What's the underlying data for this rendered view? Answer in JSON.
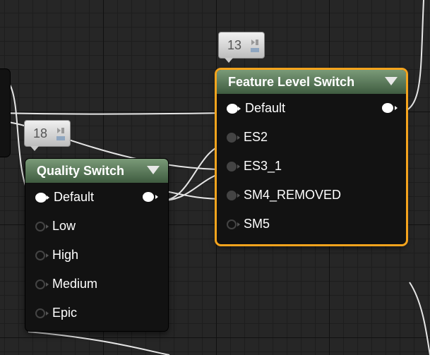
{
  "feature_level_node": {
    "title": "Feature Level Switch",
    "badge": "13",
    "pins": [
      "Default",
      "ES2",
      "ES3_1",
      "SM4_REMOVED",
      "SM5"
    ]
  },
  "quality_node": {
    "title": "Quality Switch",
    "badge": "18",
    "pins": [
      "Default",
      "Low",
      "High",
      "Medium",
      "Epic"
    ]
  },
  "colors": {
    "header": "#5c7d5c",
    "selected_outline": "#f5a41d",
    "wire": "#ffffff"
  },
  "icons": [
    "pin-exec-icon",
    "dropdown-arrow-icon",
    "comment-bubble-icon"
  ]
}
